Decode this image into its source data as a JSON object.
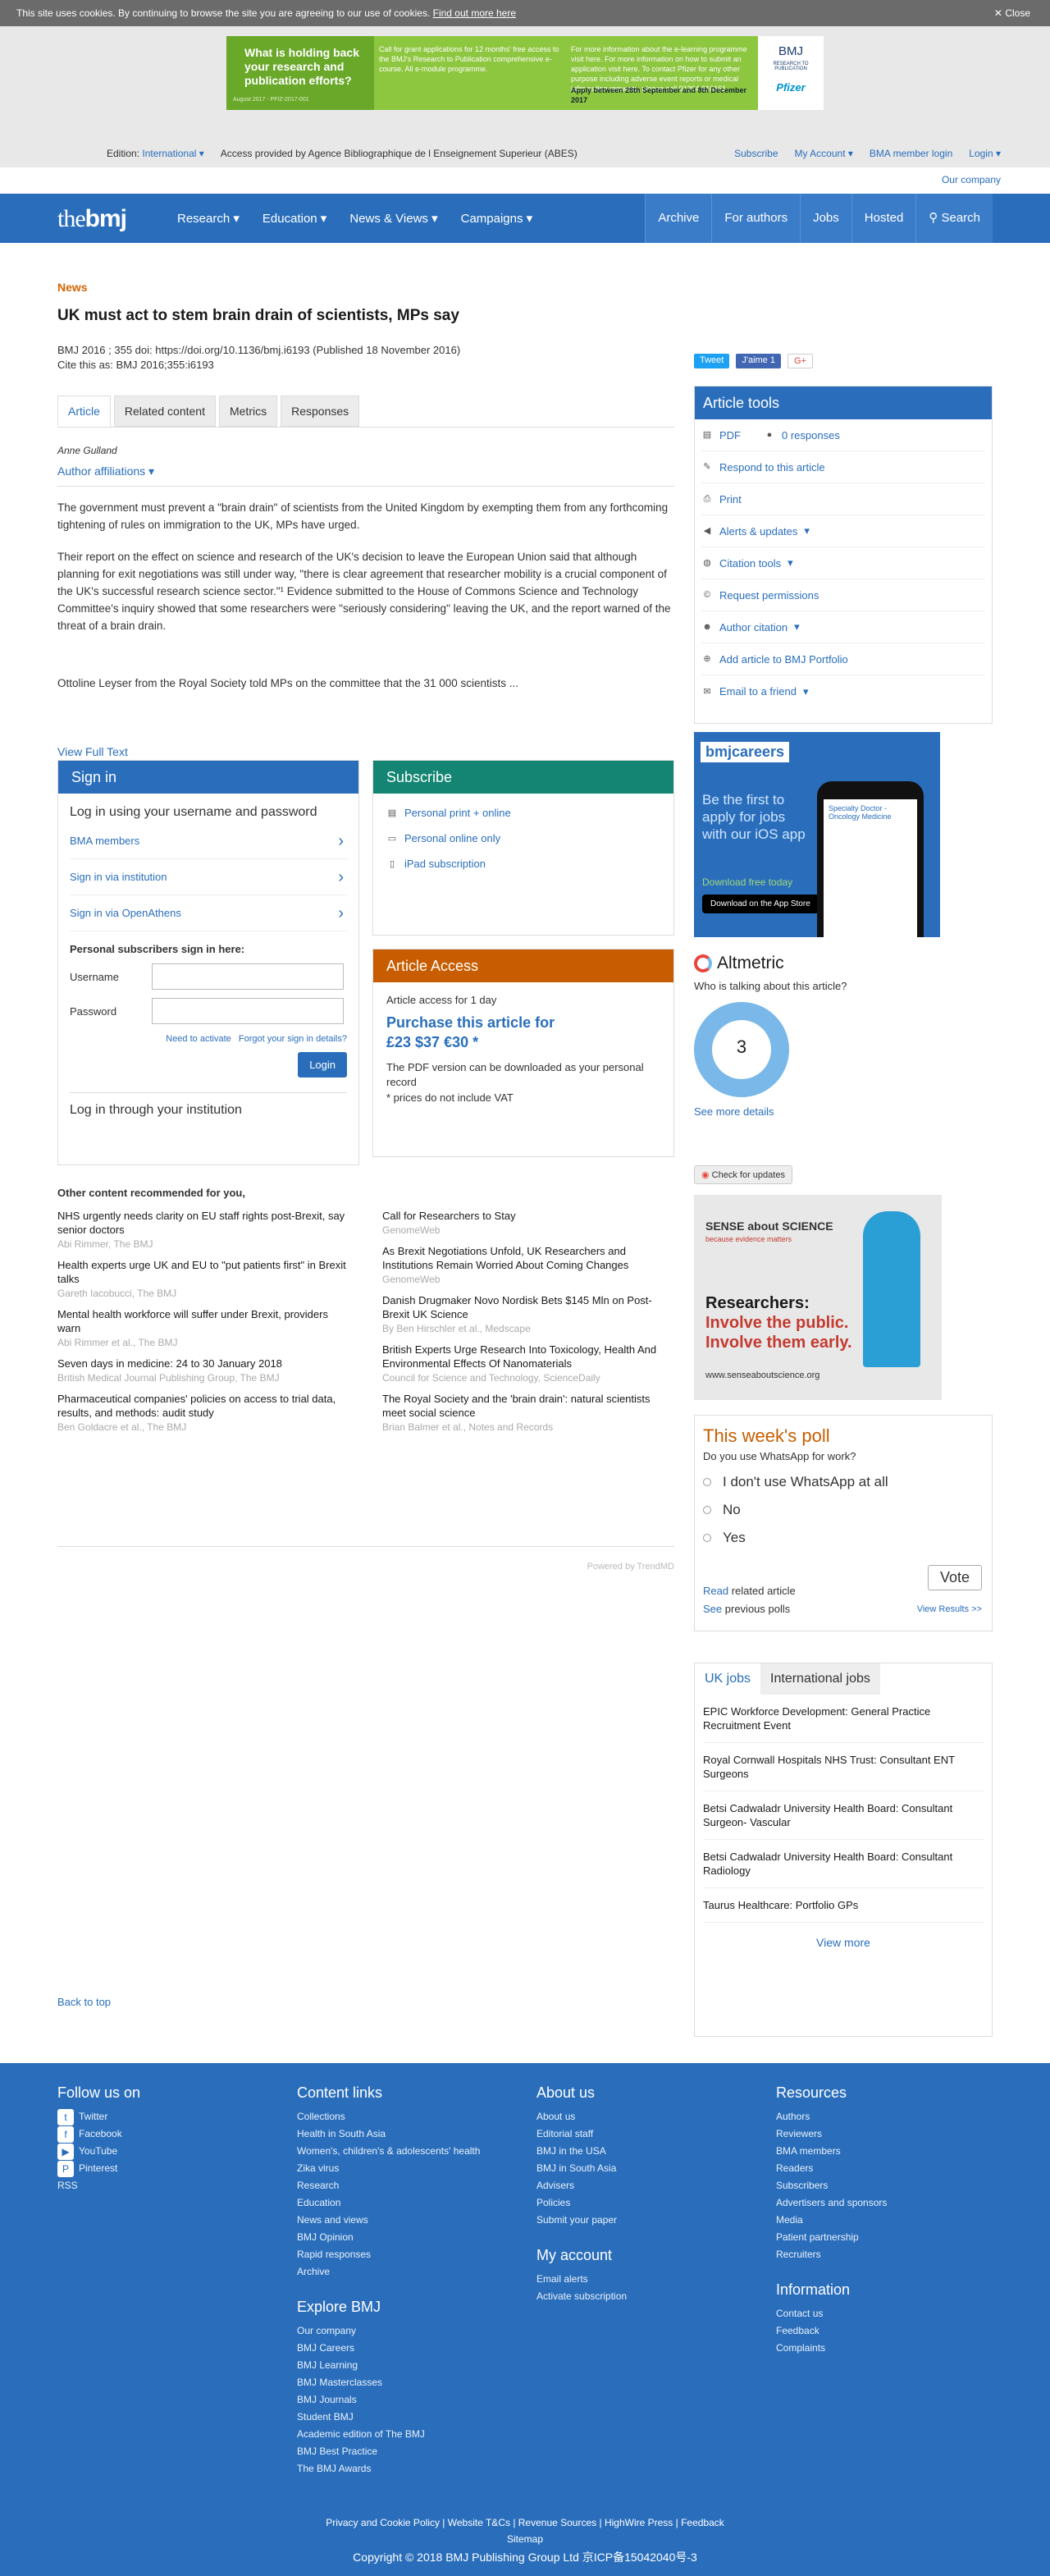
{
  "cookie": {
    "text": "This site uses cookies. By continuing to browse the site you are agreeing to our use of cookies.",
    "link": "Find out more here",
    "close": "Close"
  },
  "ad": {
    "headline": "What is holding back your research and publication efforts?",
    "small": "August 2017 - PFIZ-2017-001",
    "col1": "Call for grant applications for 12 months' free access to the BMJ's Research to Publication comprehensive e-course. All e-module programme.",
    "col2": "For more information about the e-learning programme visit here. For more information on how to submit an application visit here. To contact Pfizer for any other purpose including adverse event reports or medical information requests, please call 01304 616161",
    "dates": "Apply between 28th September and 8th December 2017",
    "brand": "BMJ",
    "brand_sub": "RESEARCH TO PUBLICATION",
    "sponsor": "Pfizer"
  },
  "edition": {
    "label": "Edition:",
    "value": "International",
    "access": "Access provided by Agence Bibliographique de l Enseignement Superieur (ABES)",
    "subscribe": "Subscribe",
    "account": "My Account",
    "bma": "BMA member login",
    "login": "Login",
    "company": "Our company"
  },
  "nav": {
    "logo_a": "the",
    "logo_b": "bmj",
    "items": [
      "Research",
      "Education",
      "News & Views",
      "Campaigns"
    ],
    "right": [
      "Archive",
      "For authors",
      "Jobs",
      "Hosted",
      "Search"
    ]
  },
  "article": {
    "section": "News",
    "title": "UK must act to stem brain drain of scientists, MPs say",
    "cite1": "BMJ  2016 ; 355  doi: https://doi.org/10.1136/bmj.i6193 (Published 18 November 2016)",
    "cite2": "Cite this as:  BMJ  2016;355:i6193",
    "tabs": [
      "Article",
      "Related content",
      "Metrics",
      "Responses"
    ],
    "author": "Anne Gulland",
    "affiliations": "Author affiliations",
    "p1": "The government must prevent a \"brain drain\" of scientists from the United Kingdom by exempting them from any forthcoming tightening of rules on immigration to the UK, MPs have urged.",
    "p2": "Their report on the effect on science and research of the UK's decision to leave the European Union said that although planning for exit negotiations was still under way, \"there is clear agreement that researcher mobility is a crucial component of the UK's successful research science sector.\"¹ Evidence submitted to the House of Commons Science and Technology Committee's inquiry showed that some researchers were \"seriously considering\" leaving the UK, and the report warned of the threat of a brain drain.",
    "p3": "Ottoline Leyser from the Royal Society told MPs on the committee that the 31 000 scientists ...",
    "viewfull": "View Full Text"
  },
  "signin": {
    "title": "Sign in",
    "subtitle": "Log in using your username and password",
    "links": [
      "BMA members",
      "Sign in via institution",
      "Sign in via OpenAthens"
    ],
    "personal": "Personal subscribers sign in here:",
    "username": "Username",
    "password": "Password",
    "activate": "Need to activate",
    "forgot": "Forgot your sign in details?",
    "button": "Login",
    "institution": "Log in through your institution"
  },
  "subscribe": {
    "title": "Subscribe",
    "items": [
      "Personal print + online",
      "Personal online only",
      "iPad subscription"
    ]
  },
  "access": {
    "title": "Article Access",
    "day": "Article access for 1 day",
    "purchase": "Purchase this article for",
    "price": "£23 $37 €30 *",
    "note1": "The PDF version can be downloaded as your personal record",
    "note2": "* prices do not include VAT"
  },
  "recommended": {
    "title": "Other content recommended for you,",
    "left": [
      {
        "t": "NHS urgently needs clarity on EU staff rights post-Brexit, say senior doctors",
        "s": "Abi Rimmer, The BMJ"
      },
      {
        "t": "Health experts urge UK and EU to \"put patients first\" in Brexit talks",
        "s": "Gareth Iacobucci, The BMJ"
      },
      {
        "t": "Mental health workforce will suffer under Brexit, providers warn",
        "s": "Abi Rimmer et al., The BMJ"
      },
      {
        "t": "Seven days in medicine: 24 to 30 January 2018",
        "s": "British Medical Journal Publishing Group, The BMJ"
      },
      {
        "t": "Pharmaceutical companies' policies on access to trial data, results, and methods: audit study",
        "s": "Ben Goldacre et al., The BMJ"
      }
    ],
    "right": [
      {
        "t": "Call for Researchers to Stay",
        "s": "GenomeWeb"
      },
      {
        "t": "As Brexit Negotiations Unfold, UK Researchers and Institutions Remain Worried About Coming Changes",
        "s": "GenomeWeb"
      },
      {
        "t": "Danish Drugmaker Novo Nordisk Bets $145 Mln on Post-Brexit UK Science",
        "s": "By Ben Hirschler et al., Medscape"
      },
      {
        "t": "British Experts Urge Research Into Toxicology, Health And Environmental Effects Of Nanomaterials",
        "s": "Council for Science and Technology, ScienceDaily"
      },
      {
        "t": "The Royal Society and the 'brain drain': natural scientists meet social science",
        "s": "Brian Balmer et al., Notes and Records"
      }
    ],
    "powered": "Powered by TrendMD"
  },
  "backtop": "Back to top",
  "share": [
    "Tweet",
    "J'aime 1",
    "G+"
  ],
  "tools": {
    "title": "Article tools",
    "items": [
      "PDF",
      "Respond to this article",
      "Print",
      "Alerts & updates",
      "Citation tools",
      "Request permissions",
      "Author citation",
      "Add article to BMJ Portfolio",
      "Email to a friend"
    ],
    "responses": "0 responses"
  },
  "careers": {
    "logo": "bmjcareers",
    "text": "Be the first to apply for jobs with our iOS app",
    "download": "Download free today",
    "store": "Download on the App Store",
    "phone": "Specialty Doctor - Oncology Medicine"
  },
  "altmetric": {
    "title": "Altmetric",
    "sub": "Who is talking about this article?",
    "score": "3",
    "more": "See more details"
  },
  "cfu": "Check for updates",
  "sense": {
    "logo": "SENSE about SCIENCE",
    "tag": "because evidence matters",
    "line1": "Researchers:",
    "line2": "Involve the public.",
    "line3": "Involve them early.",
    "url": "www.senseaboutscience.org"
  },
  "poll": {
    "title": "This week's poll",
    "q": "Do you use WhatsApp for work?",
    "options": [
      "I don't use WhatsApp at all",
      "No",
      "Yes"
    ],
    "vote": "Vote",
    "read_a": "Read",
    "read_b": "related article",
    "see_a": "See",
    "see_b": "previous polls",
    "results": "View Results >>"
  },
  "jobs": {
    "tabs": [
      "UK jobs",
      "International jobs"
    ],
    "items": [
      "EPIC Workforce Development: General Practice Recruitment Event",
      "Royal Cornwall Hospitals NHS Trust: Consultant ENT Surgeons",
      "Betsi Cadwaladr University Health Board: Consultant Surgeon- Vascular",
      "Betsi Cadwaladr University Health Board: Consultant Radiology",
      "Taurus Healthcare: Portfolio GPs"
    ],
    "more": "View more"
  },
  "footer": {
    "cols": [
      {
        "h": "Follow us on",
        "items": [
          "Twitter",
          "Facebook",
          "YouTube",
          "Pinterest",
          "RSS"
        ],
        "h2": "",
        "items2": []
      },
      {
        "h": "Content links",
        "items": [
          "Collections",
          "Health in South Asia",
          "Women's, children's & adolescents' health",
          "Zika virus",
          "Research",
          "Education",
          "News and views",
          "BMJ Opinion",
          "Rapid responses",
          "Archive"
        ],
        "h2": "Explore BMJ",
        "items2": [
          "Our company",
          "BMJ Careers",
          "BMJ Learning",
          "BMJ Masterclasses",
          "BMJ Journals",
          "Student BMJ",
          "Academic edition of The BMJ",
          "BMJ Best Practice",
          "The BMJ Awards"
        ]
      },
      {
        "h": "About us",
        "items": [
          "About us",
          "Editorial staff",
          "BMJ in the USA",
          "BMJ in South Asia",
          "Advisers",
          "Policies",
          "Submit your paper"
        ],
        "h2": "My account",
        "items2": [
          "Email alerts",
          "Activate subscription"
        ]
      },
      {
        "h": "Resources",
        "items": [
          "Authors",
          "Reviewers",
          "BMA members",
          "Readers",
          "Subscribers",
          "Advertisers and sponsors",
          "Media",
          "Patient partnership",
          "Recruiters"
        ],
        "h2": "Information",
        "items2": [
          "Contact us",
          "Feedback",
          "Complaints"
        ]
      }
    ],
    "legal": "Privacy and Cookie Policy | Website T&Cs | Revenue Sources | HighWire Press | Feedback",
    "sitemap": "Sitemap",
    "copy": "Copyright © 2018 BMJ Publishing Group Ltd   京ICP备15042040号-3"
  },
  "colors": {
    "brand": "#2a6ebb",
    "subscribe": "#138572",
    "access": "#c75d00"
  }
}
